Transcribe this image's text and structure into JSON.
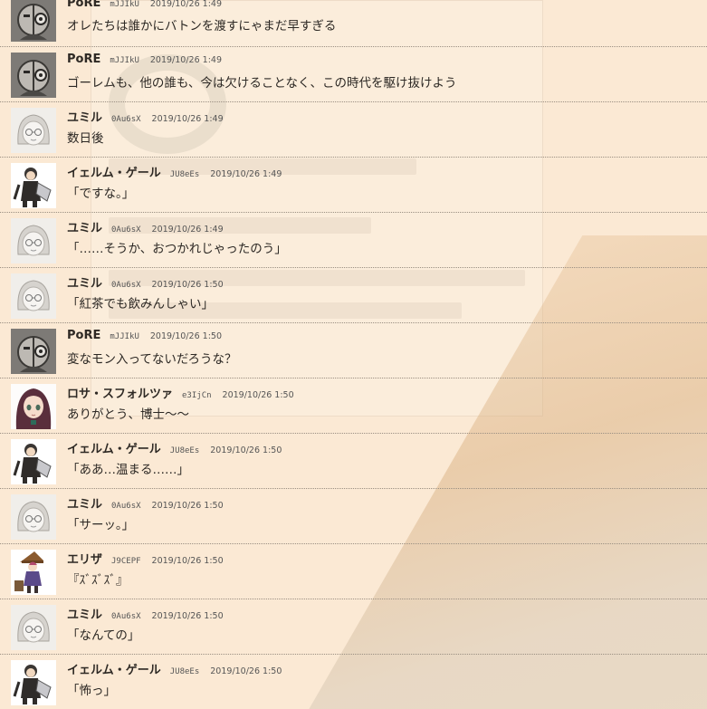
{
  "messages": [
    {
      "avatar": "pore",
      "name": "PoRE",
      "id": "mJJIkU",
      "time": "2019/10/26 1:49",
      "text": "オレたちは誰かにバトンを渡すにゃまだ早すぎる"
    },
    {
      "avatar": "pore",
      "name": "PoRE",
      "id": "mJJIkU",
      "time": "2019/10/26 1:49",
      "text": "ゴーレムも、他の誰も、今は欠けることなく、この時代を駆け抜けよう"
    },
    {
      "avatar": "yumiru",
      "name": "ユミル",
      "id": "0Au6sX",
      "time": "2019/10/26 1:49",
      "text": "数日後"
    },
    {
      "avatar": "ielmu",
      "name": "イェルム・ゲール",
      "id": "JU8eEs",
      "time": "2019/10/26 1:49",
      "text": "「ですな。」"
    },
    {
      "avatar": "yumiru",
      "name": "ユミル",
      "id": "0Au6sX",
      "time": "2019/10/26 1:49",
      "text": "「……そうか、おつかれじゃったのう」"
    },
    {
      "avatar": "yumiru",
      "name": "ユミル",
      "id": "0Au6sX",
      "time": "2019/10/26 1:50",
      "text": "「紅茶でも飲みんしゃい」"
    },
    {
      "avatar": "pore",
      "name": "PoRE",
      "id": "mJJIkU",
      "time": "2019/10/26 1:50",
      "text": "変なモン入ってないだろうな？"
    },
    {
      "avatar": "rosa",
      "name": "ロサ・スフォルツァ",
      "id": "e3IjCn",
      "time": "2019/10/26 1:50",
      "text": "ありがとう、博士～～"
    },
    {
      "avatar": "ielmu",
      "name": "イェルム・ゲール",
      "id": "JU8eEs",
      "time": "2019/10/26 1:50",
      "text": "「ああ…温まる……」"
    },
    {
      "avatar": "yumiru",
      "name": "ユミル",
      "id": "0Au6sX",
      "time": "2019/10/26 1:50",
      "text": "「サーッ。」"
    },
    {
      "avatar": "eliza",
      "name": "エリザ",
      "id": "J9CEPF",
      "time": "2019/10/26 1:50",
      "text": "『ｽﾞｽﾞｽﾞ』"
    },
    {
      "avatar": "yumiru",
      "name": "ユミル",
      "id": "0Au6sX",
      "time": "2019/10/26 1:50",
      "text": "「なんての」"
    },
    {
      "avatar": "ielmu",
      "name": "イェルム・ゲール",
      "id": "JU8eEs",
      "time": "2019/10/26 1:50",
      "text": "「怖っ」"
    }
  ]
}
